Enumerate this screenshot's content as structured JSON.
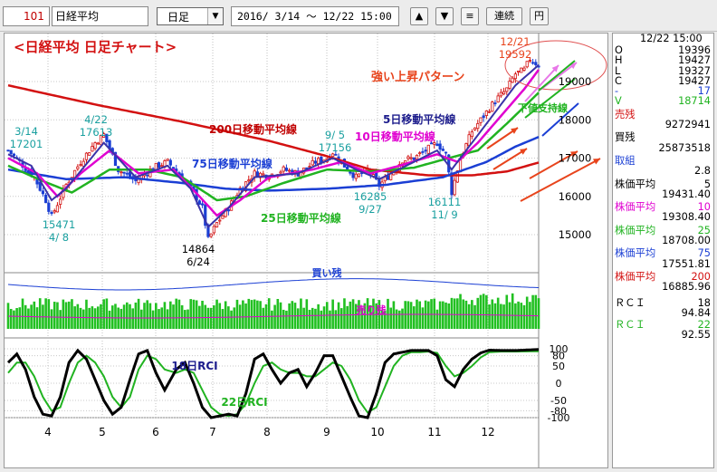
{
  "toolbar": {
    "code": "101",
    "name": "日経平均",
    "period": "日足",
    "range": "2016/ 3/14 ～ 12/22 15:00",
    "buttons": {
      "up": "▲",
      "down": "▼",
      "menu": "≡",
      "renzoku": "連続",
      "yen": "円"
    }
  },
  "chart_data": {
    "type": "line",
    "title": "<日経平均 日足チャート>",
    "x_ticks": [
      "4",
      "5",
      "6",
      "7",
      "8",
      "9",
      "10",
      "11",
      "12"
    ],
    "price_axis": {
      "ticks": [
        15000,
        16000,
        17000,
        18000,
        19000
      ],
      "ylim": [
        14600,
        19950
      ]
    },
    "series": [
      {
        "name": "5日移動平均線",
        "color": "#3a33a8"
      },
      {
        "name": "10日移動平均線",
        "color": "#e000d0"
      },
      {
        "name": "25日移動平均線",
        "color": "#21b321"
      },
      {
        "name": "75日移動平均線",
        "color": "#1b3fd4"
      },
      {
        "name": "200日移動平均線",
        "color": "#d31111"
      }
    ],
    "close_anchors": [
      {
        "t": 0,
        "v": 17200
      },
      {
        "t": 4,
        "v": 16900
      },
      {
        "t": 9,
        "v": 16500
      },
      {
        "t": 13,
        "v": 15900
      },
      {
        "t": 15,
        "v": 15471
      },
      {
        "t": 20,
        "v": 16300
      },
      {
        "t": 25,
        "v": 16900
      },
      {
        "t": 30,
        "v": 17400
      },
      {
        "t": 33,
        "v": 17613
      },
      {
        "t": 38,
        "v": 16700
      },
      {
        "t": 44,
        "v": 16400
      },
      {
        "t": 50,
        "v": 16750
      },
      {
        "t": 55,
        "v": 16900
      },
      {
        "t": 60,
        "v": 16500
      },
      {
        "t": 64,
        "v": 16100
      },
      {
        "t": 67,
        "v": 15700
      },
      {
        "t": 69,
        "v": 14864
      },
      {
        "t": 72,
        "v": 15300
      },
      {
        "t": 76,
        "v": 15700
      },
      {
        "t": 80,
        "v": 16200
      },
      {
        "t": 85,
        "v": 16600
      },
      {
        "t": 90,
        "v": 16550
      },
      {
        "t": 95,
        "v": 16700
      },
      {
        "t": 100,
        "v": 16600
      },
      {
        "t": 106,
        "v": 16900
      },
      {
        "t": 110,
        "v": 17000
      },
      {
        "t": 112,
        "v": 17156
      },
      {
        "t": 116,
        "v": 16800
      },
      {
        "t": 120,
        "v": 16500
      },
      {
        "t": 124,
        "v": 16700
      },
      {
        "t": 128,
        "v": 16285
      },
      {
        "t": 132,
        "v": 16600
      },
      {
        "t": 136,
        "v": 16950
      },
      {
        "t": 140,
        "v": 17000
      },
      {
        "t": 144,
        "v": 17200
      },
      {
        "t": 148,
        "v": 17400
      },
      {
        "t": 151,
        "v": 17100
      },
      {
        "t": 153,
        "v": 16111
      },
      {
        "t": 156,
        "v": 17000
      },
      {
        "t": 160,
        "v": 17700
      },
      {
        "t": 164,
        "v": 18100
      },
      {
        "t": 168,
        "v": 18500
      },
      {
        "t": 172,
        "v": 18800
      },
      {
        "t": 175,
        "v": 19200
      },
      {
        "t": 178,
        "v": 19300
      },
      {
        "t": 180,
        "v": 19592
      },
      {
        "t": 183,
        "v": 19427
      }
    ],
    "ma_anchors": {
      "ma5": [
        [
          0,
          17100
        ],
        [
          8,
          16800
        ],
        [
          15,
          15900
        ],
        [
          20,
          16200
        ],
        [
          33,
          17400
        ],
        [
          44,
          16500
        ],
        [
          55,
          16800
        ],
        [
          63,
          16200
        ],
        [
          69,
          15200
        ],
        [
          76,
          15700
        ],
        [
          85,
          16500
        ],
        [
          100,
          16600
        ],
        [
          112,
          17000
        ],
        [
          120,
          16700
        ],
        [
          128,
          16450
        ],
        [
          140,
          16900
        ],
        [
          148,
          17200
        ],
        [
          153,
          16700
        ],
        [
          160,
          17400
        ],
        [
          168,
          18200
        ],
        [
          175,
          18900
        ],
        [
          183,
          19431
        ]
      ],
      "ma10": [
        [
          0,
          17000
        ],
        [
          10,
          16600
        ],
        [
          17,
          16000
        ],
        [
          25,
          16600
        ],
        [
          35,
          17200
        ],
        [
          45,
          16600
        ],
        [
          57,
          16700
        ],
        [
          66,
          16000
        ],
        [
          72,
          15500
        ],
        [
          80,
          15900
        ],
        [
          90,
          16500
        ],
        [
          105,
          16700
        ],
        [
          115,
          16900
        ],
        [
          125,
          16600
        ],
        [
          135,
          16800
        ],
        [
          148,
          17100
        ],
        [
          155,
          16900
        ],
        [
          162,
          17400
        ],
        [
          170,
          18100
        ],
        [
          178,
          18800
        ],
        [
          183,
          19308
        ]
      ],
      "ma25": [
        [
          0,
          16800
        ],
        [
          12,
          16400
        ],
        [
          22,
          16100
        ],
        [
          35,
          16700
        ],
        [
          48,
          16700
        ],
        [
          60,
          16500
        ],
        [
          72,
          15900
        ],
        [
          82,
          16000
        ],
        [
          95,
          16350
        ],
        [
          110,
          16700
        ],
        [
          125,
          16650
        ],
        [
          140,
          16750
        ],
        [
          152,
          17000
        ],
        [
          162,
          17200
        ],
        [
          172,
          17900
        ],
        [
          183,
          18708
        ]
      ],
      "ma75": [
        [
          0,
          16700
        ],
        [
          20,
          16450
        ],
        [
          40,
          16500
        ],
        [
          60,
          16350
        ],
        [
          75,
          16200
        ],
        [
          90,
          16150
        ],
        [
          110,
          16200
        ],
        [
          130,
          16300
        ],
        [
          150,
          16500
        ],
        [
          165,
          16900
        ],
        [
          175,
          17300
        ],
        [
          183,
          17551
        ]
      ],
      "ma200": [
        [
          0,
          18900
        ],
        [
          30,
          18400
        ],
        [
          60,
          17950
        ],
        [
          90,
          17450
        ],
        [
          110,
          17050
        ],
        [
          125,
          16700
        ],
        [
          145,
          16550
        ],
        [
          160,
          16550
        ],
        [
          172,
          16650
        ],
        [
          183,
          16885
        ]
      ]
    },
    "annotations": [
      {
        "text": "強い上昇パターン",
        "color": "#e8441c"
      },
      {
        "text": "200日移動平均線",
        "color": "#c00000"
      },
      {
        "text": "5日移動平均線",
        "color": "#1c1c8c"
      },
      {
        "text": "10日移動平均線",
        "color": "#e000d0"
      },
      {
        "text": "75日移動平均線",
        "color": "#1b3fd4"
      },
      {
        "text": "25日移動平均線",
        "color": "#21b321"
      },
      {
        "text": "下値支持線",
        "color": "#21b321"
      }
    ],
    "price_labels": [
      {
        "d1": "3/14",
        "d2": "17201",
        "color": "#1aa0a0"
      },
      {
        "d1": "4/22",
        "d2": "17613",
        "color": "#1aa0a0"
      },
      {
        "d1": "15471",
        "d2": "4/ 8",
        "color": "#1aa0a0"
      },
      {
        "d1": "14864",
        "d2": "6/24",
        "color": "#000000"
      },
      {
        "d1": "9/ 5",
        "d2": "17156",
        "color": "#1aa0a0"
      },
      {
        "d1": "16285",
        "d2": "9/27",
        "color": "#1aa0a0"
      },
      {
        "d1": "16111",
        "d2": "11/ 9",
        "color": "#1aa0a0"
      },
      {
        "d1": "12/21",
        "d2": "19592",
        "color": "#e8441c"
      }
    ],
    "volume": {
      "label_buy": "買い残",
      "label_sell": "売り残"
    },
    "rci": {
      "ticks": [
        "100",
        "80",
        "50",
        "0",
        "-50",
        "-80",
        "-100"
      ],
      "label18": "18日RCI",
      "label22": "22日RCI",
      "rci18": [
        [
          0,
          60
        ],
        [
          3,
          85
        ],
        [
          6,
          40
        ],
        [
          9,
          -40
        ],
        [
          12,
          -90
        ],
        [
          15,
          -95
        ],
        [
          18,
          -40
        ],
        [
          21,
          60
        ],
        [
          24,
          95
        ],
        [
          27,
          70
        ],
        [
          30,
          10
        ],
        [
          33,
          -50
        ],
        [
          36,
          -90
        ],
        [
          39,
          -70
        ],
        [
          42,
          10
        ],
        [
          45,
          85
        ],
        [
          48,
          95
        ],
        [
          51,
          30
        ],
        [
          54,
          -20
        ],
        [
          58,
          40
        ],
        [
          61,
          60
        ],
        [
          64,
          0
        ],
        [
          67,
          -70
        ],
        [
          70,
          -100
        ],
        [
          73,
          -95
        ],
        [
          76,
          -90
        ],
        [
          79,
          -95
        ],
        [
          82,
          -30
        ],
        [
          85,
          70
        ],
        [
          88,
          85
        ],
        [
          91,
          40
        ],
        [
          94,
          0
        ],
        [
          97,
          30
        ],
        [
          100,
          40
        ],
        [
          103,
          -10
        ],
        [
          106,
          30
        ],
        [
          109,
          80
        ],
        [
          112,
          80
        ],
        [
          115,
          20
        ],
        [
          118,
          -40
        ],
        [
          121,
          -95
        ],
        [
          124,
          -100
        ],
        [
          127,
          -30
        ],
        [
          130,
          60
        ],
        [
          133,
          85
        ],
        [
          136,
          90
        ],
        [
          139,
          95
        ],
        [
          142,
          95
        ],
        [
          145,
          95
        ],
        [
          148,
          80
        ],
        [
          151,
          10
        ],
        [
          154,
          -10
        ],
        [
          157,
          40
        ],
        [
          160,
          70
        ],
        [
          163,
          88
        ],
        [
          166,
          96
        ],
        [
          170,
          95
        ],
        [
          175,
          95
        ],
        [
          183,
          98
        ]
      ],
      "rci22": [
        [
          0,
          30
        ],
        [
          3,
          60
        ],
        [
          6,
          60
        ],
        [
          9,
          20
        ],
        [
          12,
          -40
        ],
        [
          15,
          -80
        ],
        [
          18,
          -70
        ],
        [
          21,
          0
        ],
        [
          24,
          60
        ],
        [
          27,
          80
        ],
        [
          30,
          60
        ],
        [
          33,
          20
        ],
        [
          36,
          -40
        ],
        [
          39,
          -70
        ],
        [
          42,
          -40
        ],
        [
          45,
          40
        ],
        [
          48,
          80
        ],
        [
          51,
          70
        ],
        [
          54,
          40
        ],
        [
          58,
          30
        ],
        [
          61,
          40
        ],
        [
          64,
          30
        ],
        [
          67,
          -20
        ],
        [
          70,
          -70
        ],
        [
          73,
          -90
        ],
        [
          76,
          -95
        ],
        [
          79,
          -90
        ],
        [
          82,
          -60
        ],
        [
          85,
          0
        ],
        [
          88,
          50
        ],
        [
          91,
          60
        ],
        [
          94,
          40
        ],
        [
          97,
          30
        ],
        [
          100,
          30
        ],
        [
          103,
          20
        ],
        [
          106,
          20
        ],
        [
          109,
          40
        ],
        [
          112,
          60
        ],
        [
          115,
          50
        ],
        [
          118,
          10
        ],
        [
          121,
          -50
        ],
        [
          124,
          -85
        ],
        [
          127,
          -70
        ],
        [
          130,
          -10
        ],
        [
          133,
          50
        ],
        [
          136,
          80
        ],
        [
          139,
          90
        ],
        [
          142,
          90
        ],
        [
          145,
          92
        ],
        [
          148,
          88
        ],
        [
          151,
          50
        ],
        [
          154,
          20
        ],
        [
          157,
          30
        ],
        [
          160,
          50
        ],
        [
          163,
          75
        ],
        [
          166,
          90
        ],
        [
          170,
          92
        ],
        [
          175,
          92
        ],
        [
          183,
          93
        ]
      ]
    }
  },
  "panel": {
    "header": "12/22 15:00",
    "ohlc": [
      {
        "k": "O",
        "v": "19396"
      },
      {
        "k": "H",
        "v": "19427"
      },
      {
        "k": "L",
        "v": "19327"
      },
      {
        "k": "C",
        "v": "19427"
      },
      {
        "k": "-",
        "v": "17"
      },
      {
        "k": "V",
        "v": "18714"
      }
    ],
    "urizan_label": "売残",
    "urizan": "9272941",
    "kaizan_label": "買残",
    "kaizan": "25873518",
    "torikumi_label": "取組",
    "torikumi": "2.8",
    "ma": [
      {
        "label": "株価平均",
        "n": "5",
        "v": "19431.40",
        "color": "#000000",
        "bg": ""
      },
      {
        "label": "株価平均",
        "n": "10",
        "v": "19308.40",
        "color": "#e000d0",
        "bg": ""
      },
      {
        "label": "株価平均",
        "n": "25",
        "v": "18708.00",
        "color": "#21b321",
        "bg": ""
      },
      {
        "label": "株価平均",
        "n": "75",
        "v": "17551.81",
        "color": "#1b3fd4",
        "bg": ""
      },
      {
        "label": "株価平均",
        "n": "200",
        "v": "16885.96",
        "color": "#d31111",
        "bg": ""
      }
    ],
    "rci": [
      {
        "label": "ＲＣＩ",
        "n": "18",
        "v": "94.84",
        "color": "#000000"
      },
      {
        "label": "ＲＣＩ",
        "n": "22",
        "v": "92.55",
        "color": "#21b321"
      }
    ]
  }
}
